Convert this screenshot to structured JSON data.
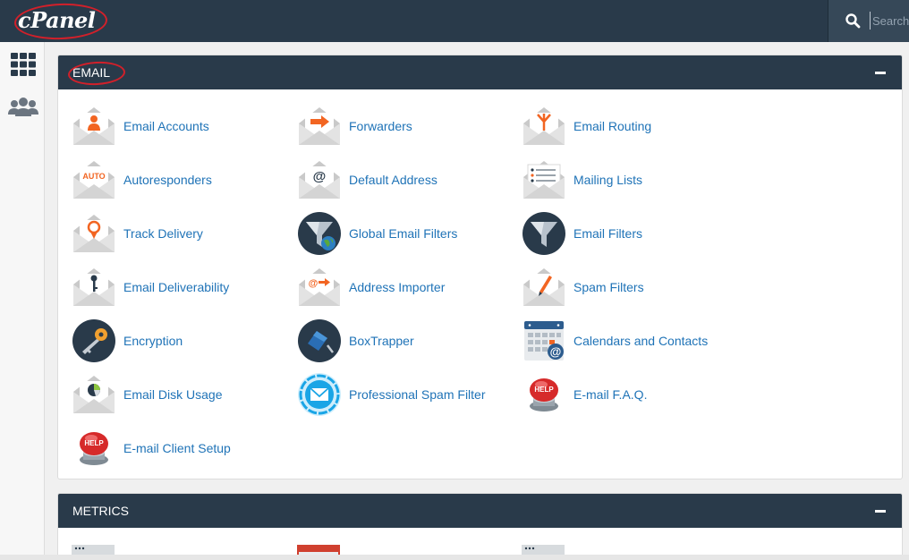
{
  "header": {
    "brand": "cPanel",
    "search": {
      "placeholder": "Search ("
    }
  },
  "leftnav": {
    "items": [
      {
        "icon": "grid-icon"
      },
      {
        "icon": "users-icon"
      }
    ]
  },
  "email": {
    "title": "EMAIL",
    "items": [
      {
        "label": "Email Accounts",
        "icon": "person-envelope"
      },
      {
        "label": "Forwarders",
        "icon": "arrow-envelope"
      },
      {
        "label": "Email Routing",
        "icon": "routing-envelope"
      },
      {
        "label": "Autoresponders",
        "icon": "auto-envelope"
      },
      {
        "label": "Default Address",
        "icon": "at-envelope"
      },
      {
        "label": "Mailing Lists",
        "icon": "list-envelope"
      },
      {
        "label": "Track Delivery",
        "icon": "pin-envelope"
      },
      {
        "label": "Global Email Filters",
        "icon": "funnel-globe"
      },
      {
        "label": "Email Filters",
        "icon": "funnel"
      },
      {
        "label": "Email Deliverability",
        "icon": "key-envelope"
      },
      {
        "label": "Address Importer",
        "icon": "at-arrow-envelope"
      },
      {
        "label": "Spam Filters",
        "icon": "pen-envelope"
      },
      {
        "label": "Encryption",
        "icon": "keys"
      },
      {
        "label": "BoxTrapper",
        "icon": "boxtrapper"
      },
      {
        "label": "Calendars and Contacts",
        "icon": "calendar-at"
      },
      {
        "label": "Email Disk Usage",
        "icon": "pie-envelope"
      },
      {
        "label": "Professional Spam Filter",
        "icon": "spam-shield"
      },
      {
        "label": "E-mail F.A.Q.",
        "icon": "help-button"
      },
      {
        "label": "E-mail Client Setup",
        "icon": "help-button"
      }
    ]
  },
  "metrics": {
    "title": "METRICS"
  },
  "colors": {
    "header": "#293a4a",
    "link": "#1f73b7",
    "accent": "#f26522",
    "annotation": "#d2202a"
  }
}
